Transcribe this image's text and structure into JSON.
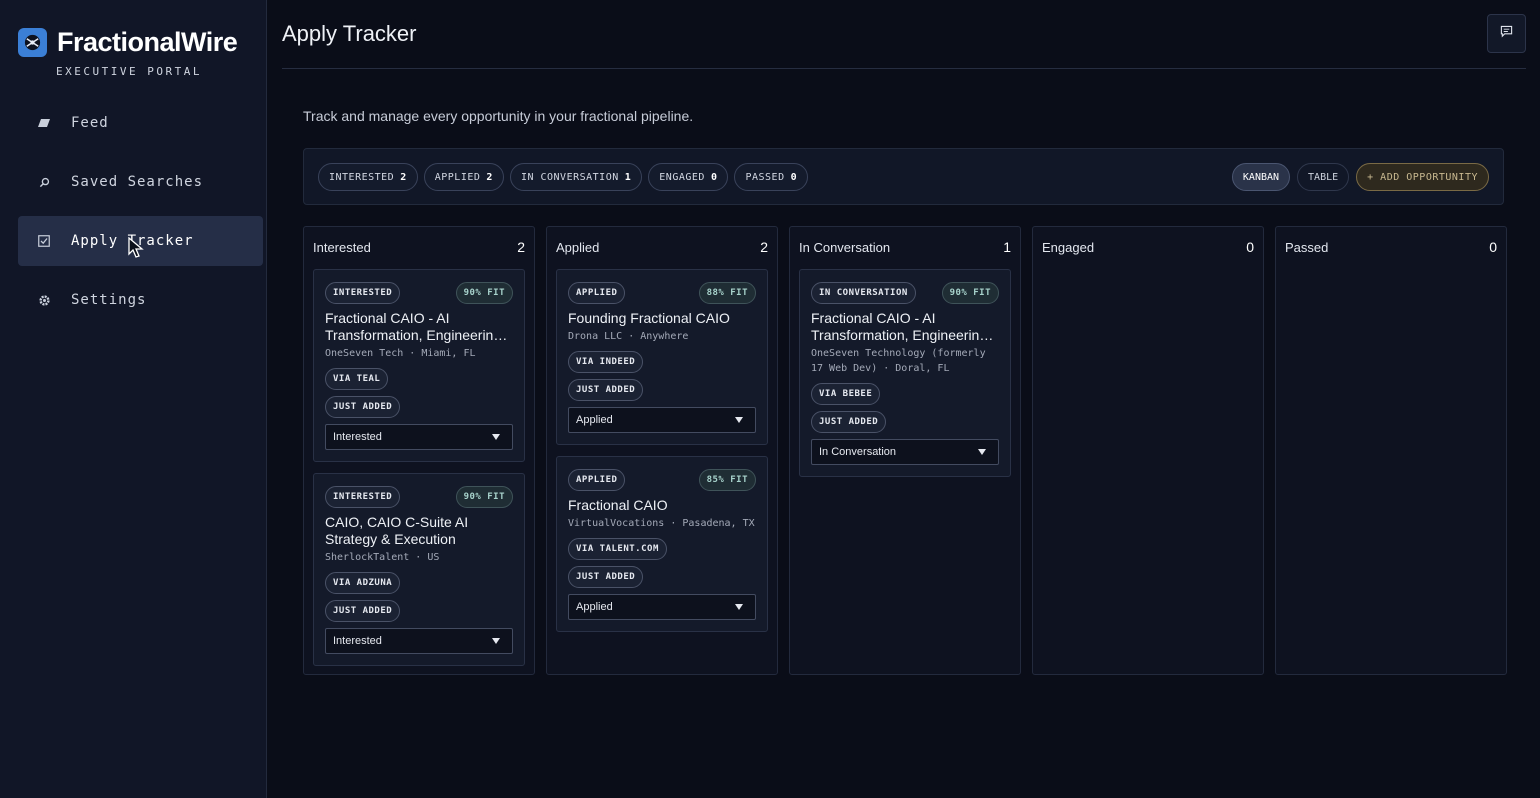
{
  "brand": {
    "name": "FractionalWire",
    "subtitle": "EXECUTIVE PORTAL",
    "accent": "#3b7fd6"
  },
  "sidebar": {
    "items": [
      {
        "label": "Feed",
        "icon": "feed-icon",
        "active": false
      },
      {
        "label": "Saved Searches",
        "icon": "search-icon",
        "active": false
      },
      {
        "label": "Apply Tracker",
        "icon": "checkbox-icon",
        "active": true
      },
      {
        "label": "Settings",
        "icon": "gear-icon",
        "active": false
      }
    ]
  },
  "header": {
    "title": "Apply Tracker",
    "feedback_icon": "message-icon"
  },
  "page": {
    "subtitle": "Track and manage every opportunity in your fractional pipeline."
  },
  "filters": [
    {
      "label": "INTERESTED",
      "count": "2"
    },
    {
      "label": "APPLIED",
      "count": "2"
    },
    {
      "label": "IN CONVERSATION",
      "count": "1"
    },
    {
      "label": "ENGAGED",
      "count": "0"
    },
    {
      "label": "PASSED",
      "count": "0"
    }
  ],
  "views": {
    "kanban": "KANBAN",
    "table": "TABLE",
    "add": "+ ADD OPPORTUNITY"
  },
  "columns": [
    {
      "title": "Interested",
      "count": "2",
      "cards": [
        {
          "status": "INTERESTED",
          "fit": "90% FIT",
          "title": "Fractional CAIO - AI Transformation, Engineering Leadership",
          "meta": "OneSeven Tech · Miami, FL",
          "source": "VIA TEAL",
          "added": "JUST ADDED",
          "select": "Interested"
        },
        {
          "status": "INTERESTED",
          "fit": "90% FIT",
          "title": "CAIO, CAIO C-Suite AI Strategy & Execution",
          "meta": "SherlockTalent · US",
          "source": "VIA ADZUNA",
          "added": "JUST ADDED",
          "select": "Interested"
        }
      ]
    },
    {
      "title": "Applied",
      "count": "2",
      "cards": [
        {
          "status": "APPLIED",
          "fit": "88% FIT",
          "title": "Founding Fractional CAIO",
          "meta": "Drona LLC · Anywhere",
          "source": "VIA INDEED",
          "added": "JUST ADDED",
          "select": "Applied"
        },
        {
          "status": "APPLIED",
          "fit": "85% FIT",
          "title": "Fractional CAIO",
          "meta": "VirtualVocations · Pasadena, TX",
          "source": "VIA TALENT.COM",
          "added": "JUST ADDED",
          "select": "Applied"
        }
      ]
    },
    {
      "title": "In Conversation",
      "count": "1",
      "cards": [
        {
          "status": "IN CONVERSATION",
          "fit": "90% FIT",
          "title": "Fractional CAIO - AI Transformation, Engineering Leadership",
          "meta": "OneSeven Technology (formerly 17 Web Dev) · Doral, FL",
          "source": "VIA BEBEE",
          "added": "JUST ADDED",
          "select": "In Conversation"
        }
      ]
    },
    {
      "title": "Engaged",
      "count": "0",
      "cards": []
    },
    {
      "title": "Passed",
      "count": "0",
      "cards": []
    }
  ]
}
